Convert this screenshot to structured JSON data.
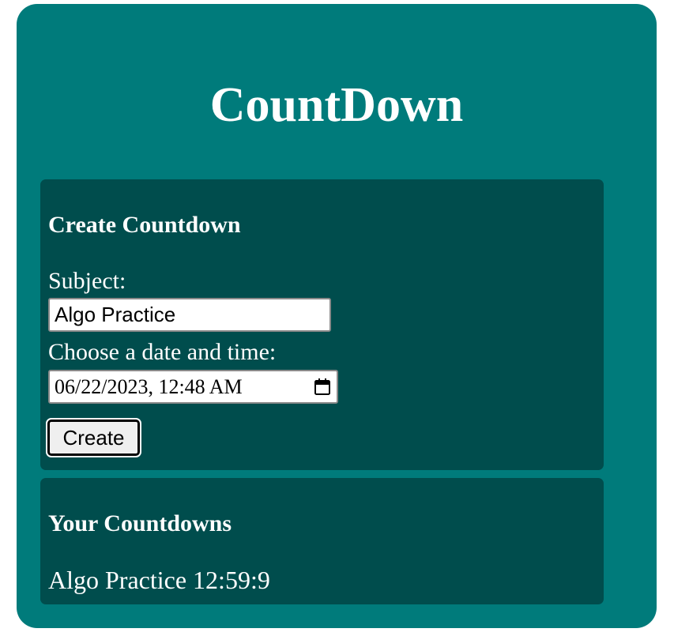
{
  "app": {
    "title": "CountDown"
  },
  "create": {
    "heading": "Create Countdown",
    "subject_label": "Subject:",
    "subject_value": "Algo Practice",
    "date_label": "Choose a date and time:",
    "date_value": "06/22/2023, 12:48 AM",
    "create_button": "Create",
    "calendar_icon": "calendar-icon"
  },
  "countdowns": {
    "heading": "Your Countdowns",
    "items": [
      {
        "subject": "Algo Practice",
        "remaining": "12:59:9",
        "text": "Algo Practice 12:59:9"
      }
    ]
  },
  "colors": {
    "app_background": "#007b7b",
    "panel_background": "#004d4d",
    "text": "#ffffff"
  }
}
